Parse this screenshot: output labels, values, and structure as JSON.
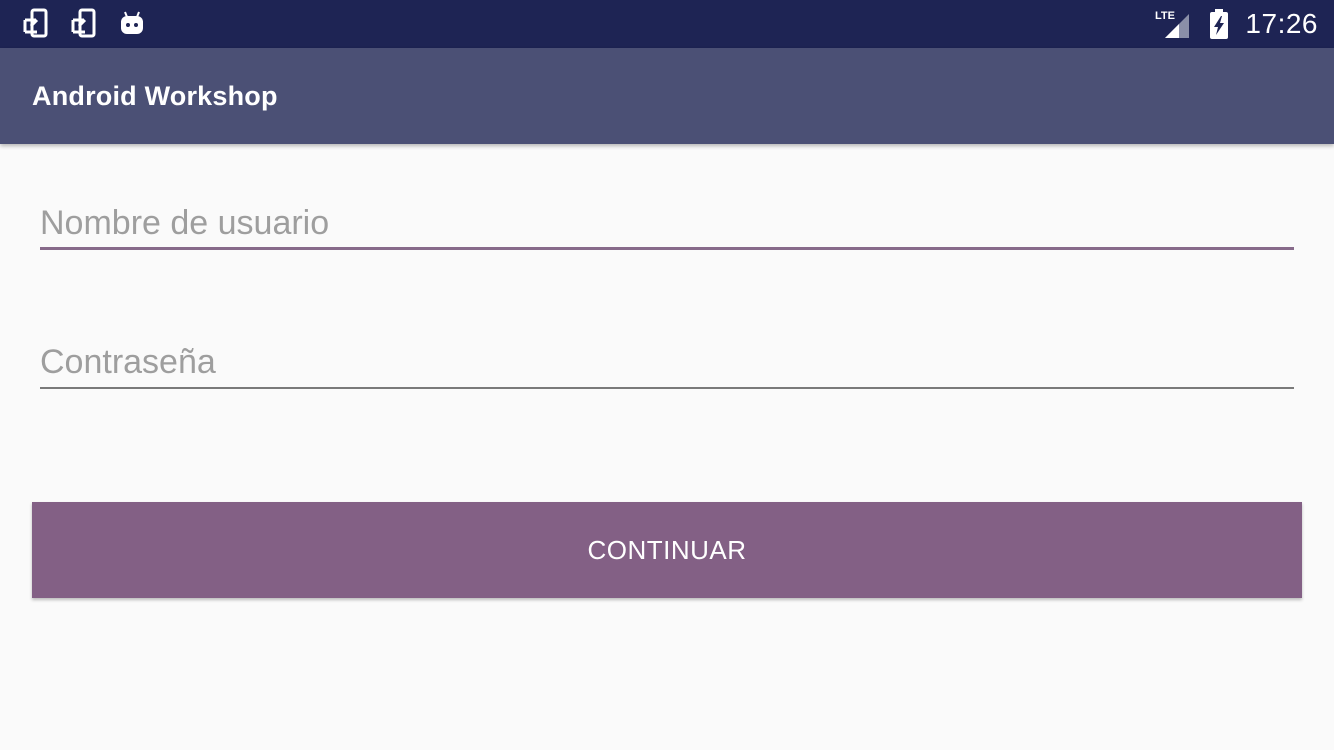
{
  "status_bar": {
    "icons_left": [
      "screen-rotation-icon",
      "screen-rotation-icon",
      "android-icon"
    ],
    "network_label": "LTE",
    "icons_right": [
      "signal-icon",
      "battery-charging-icon"
    ],
    "time": "17:26",
    "color": "#1e2454"
  },
  "app_bar": {
    "title": "Android Workshop",
    "color": "#4b5075"
  },
  "form": {
    "username_placeholder": "Nombre de usuario",
    "password_placeholder": "Contraseña",
    "accent_color": "#876a8a"
  },
  "continue_button": {
    "label": "CONTINUAR",
    "color": "#836085"
  }
}
